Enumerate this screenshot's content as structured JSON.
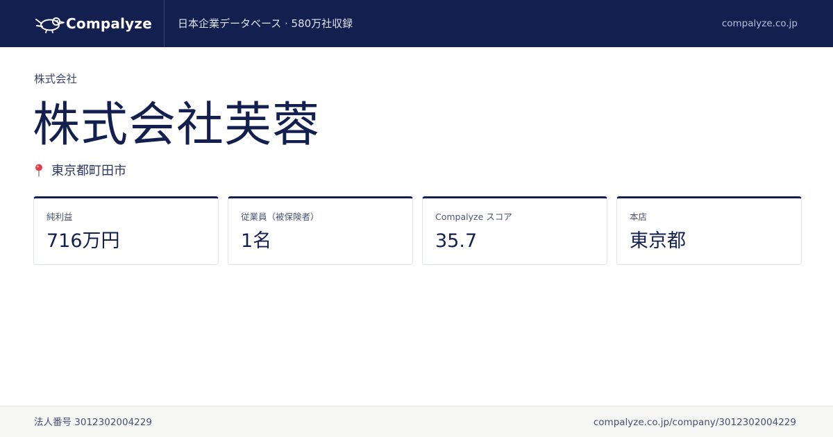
{
  "brand": {
    "name": "Compalyze",
    "tagline": "日本企業データベース · 580万社収録",
    "site": "compalyze.co.jp",
    "logo_icon": "bird-logo-icon"
  },
  "company": {
    "type_label": "株式会社",
    "name": "株式会社芙蓉",
    "location_icon": "map-pin-icon",
    "location": "東京都町田市"
  },
  "metrics": [
    {
      "label": "純利益",
      "value": "716万円"
    },
    {
      "label": "従業員（被保険者）",
      "value": "1名"
    },
    {
      "label": "Compalyze スコア",
      "value": "35.7"
    },
    {
      "label": "本店",
      "value": "東京都"
    }
  ],
  "footer": {
    "corporate_number": "法人番号 3012302004229",
    "url": "compalyze.co.jp/company/3012302004229"
  },
  "colors": {
    "header_bg": "#131f4e",
    "accent": "#131f4e",
    "pin": "#e0404a",
    "footer_bg": "#f6f6f4"
  }
}
